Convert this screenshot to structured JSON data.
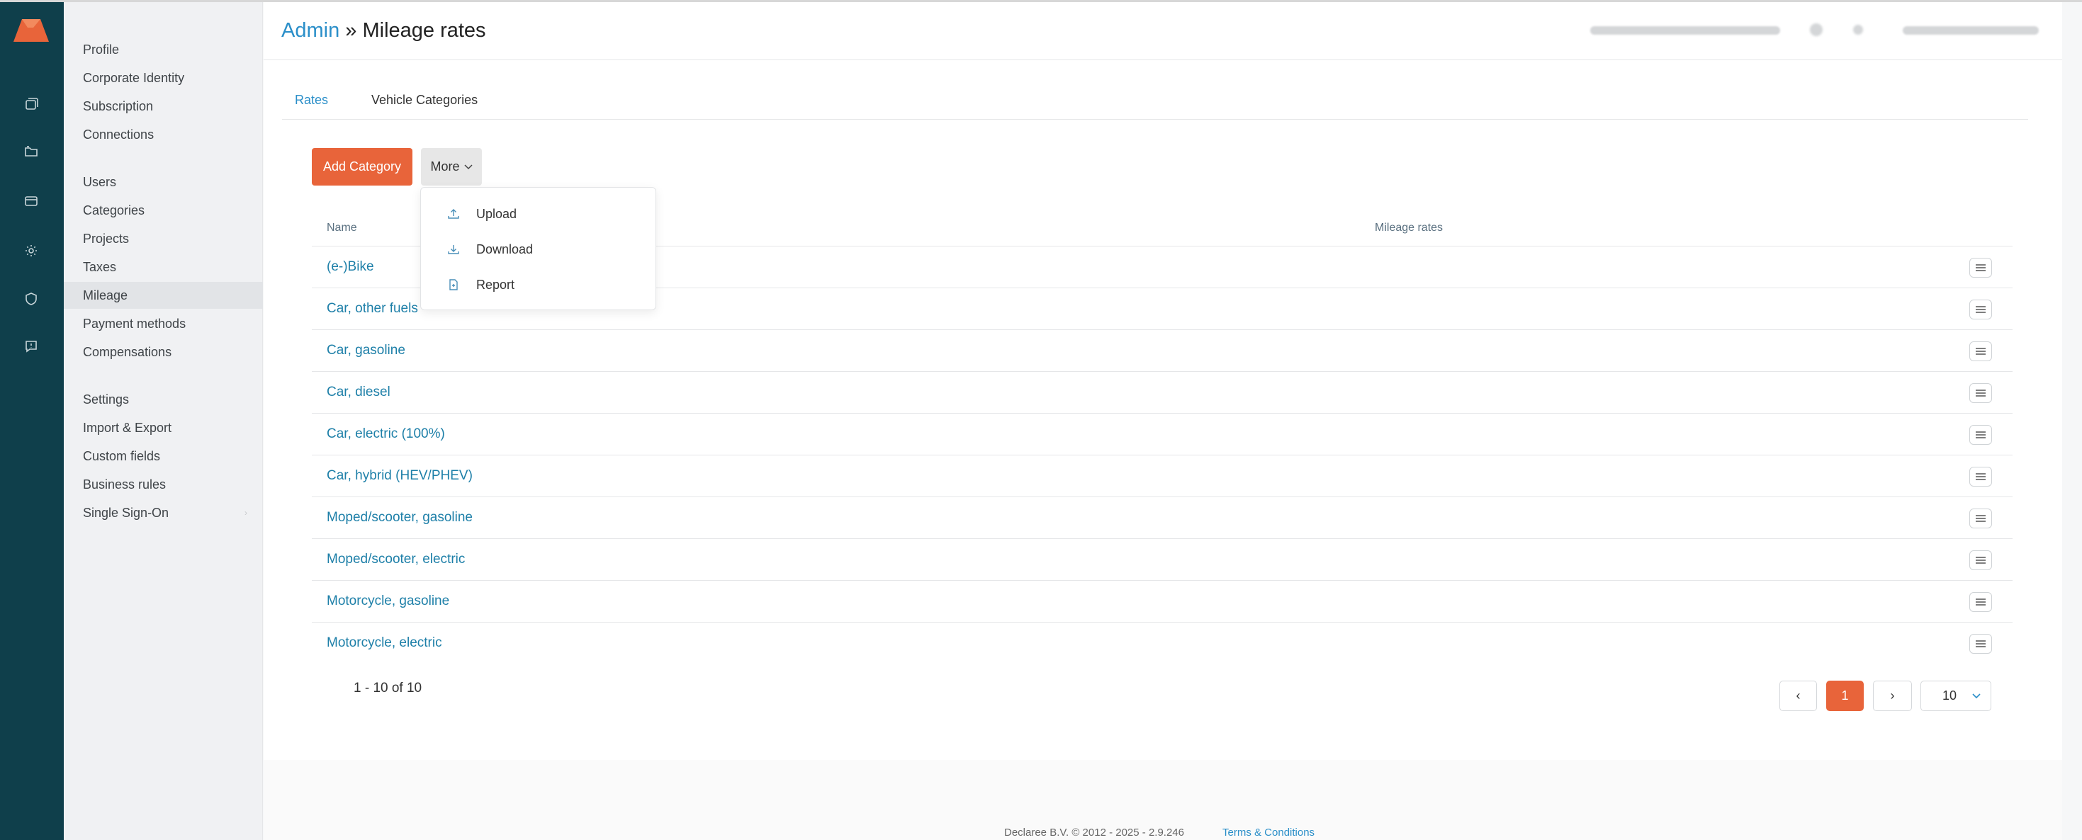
{
  "icons": {
    "logo": "app-logo",
    "rail": [
      "stack-icon",
      "folder-icon",
      "card-icon",
      "gear-icon",
      "shield-icon",
      "chat-icon"
    ]
  },
  "colors": {
    "accent": "#e8643a",
    "link": "#2b8fc9",
    "rail": "#0f3f4b"
  },
  "sidebar": {
    "groups": [
      [
        "Profile",
        "Corporate Identity",
        "Subscription",
        "Connections"
      ],
      [
        "Users",
        "Categories",
        "Projects",
        "Taxes",
        "Mileage",
        "Payment methods",
        "Compensations"
      ],
      [
        "Settings",
        "Import & Export",
        "Custom fields",
        "Business rules",
        "Single Sign-On"
      ]
    ],
    "active": "Mileage"
  },
  "header": {
    "crumb": "Admin",
    "separator": "»",
    "title": "Mileage rates"
  },
  "tabs": [
    "Rates",
    "Vehicle Categories"
  ],
  "toolbar": {
    "add_label": "Add Category",
    "more_label": "More"
  },
  "more_menu": [
    {
      "label": "Upload",
      "icon": "upload-icon"
    },
    {
      "label": "Download",
      "icon": "download-icon"
    },
    {
      "label": "Report",
      "icon": "report-icon"
    }
  ],
  "table": {
    "columns": [
      "Name",
      "Mileage rates"
    ],
    "rows": [
      "(e-)Bike",
      "Car, other fuels",
      "Car, gasoline",
      "Car, diesel",
      "Car, electric (100%)",
      "Car, hybrid (HEV/PHEV)",
      "Moped/scooter, gasoline",
      "Moped/scooter, electric",
      "Motorcycle, gasoline",
      "Motorcycle, electric"
    ]
  },
  "pagination": {
    "info": "1 - 10 of 10",
    "prev": "‹",
    "current": "1",
    "next": "›",
    "page_size": "10"
  },
  "footer": {
    "copyright": "Declaree B.V. © 2012 - 2025 - 2.9.246",
    "terms": "Terms & Conditions"
  }
}
